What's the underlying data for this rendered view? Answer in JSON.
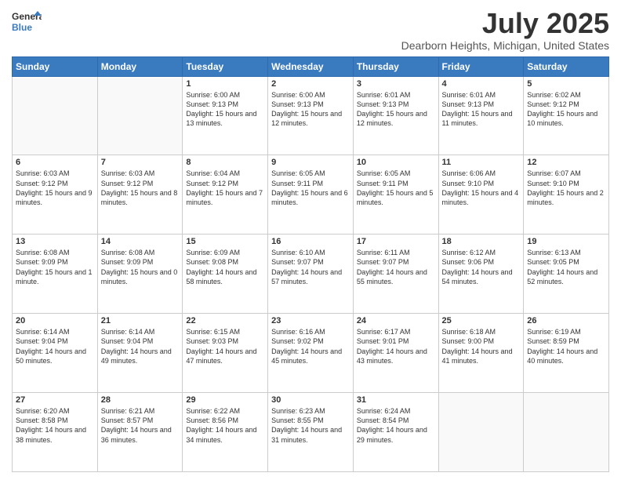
{
  "logo": {
    "line1": "General",
    "line2": "Blue"
  },
  "title": "July 2025",
  "subtitle": "Dearborn Heights, Michigan, United States",
  "headers": [
    "Sunday",
    "Monday",
    "Tuesday",
    "Wednesday",
    "Thursday",
    "Friday",
    "Saturday"
  ],
  "weeks": [
    [
      {
        "day": "",
        "info": ""
      },
      {
        "day": "",
        "info": ""
      },
      {
        "day": "1",
        "info": "Sunrise: 6:00 AM\nSunset: 9:13 PM\nDaylight: 15 hours and 13 minutes."
      },
      {
        "day": "2",
        "info": "Sunrise: 6:00 AM\nSunset: 9:13 PM\nDaylight: 15 hours and 12 minutes."
      },
      {
        "day": "3",
        "info": "Sunrise: 6:01 AM\nSunset: 9:13 PM\nDaylight: 15 hours and 12 minutes."
      },
      {
        "day": "4",
        "info": "Sunrise: 6:01 AM\nSunset: 9:13 PM\nDaylight: 15 hours and 11 minutes."
      },
      {
        "day": "5",
        "info": "Sunrise: 6:02 AM\nSunset: 9:12 PM\nDaylight: 15 hours and 10 minutes."
      }
    ],
    [
      {
        "day": "6",
        "info": "Sunrise: 6:03 AM\nSunset: 9:12 PM\nDaylight: 15 hours and 9 minutes."
      },
      {
        "day": "7",
        "info": "Sunrise: 6:03 AM\nSunset: 9:12 PM\nDaylight: 15 hours and 8 minutes."
      },
      {
        "day": "8",
        "info": "Sunrise: 6:04 AM\nSunset: 9:12 PM\nDaylight: 15 hours and 7 minutes."
      },
      {
        "day": "9",
        "info": "Sunrise: 6:05 AM\nSunset: 9:11 PM\nDaylight: 15 hours and 6 minutes."
      },
      {
        "day": "10",
        "info": "Sunrise: 6:05 AM\nSunset: 9:11 PM\nDaylight: 15 hours and 5 minutes."
      },
      {
        "day": "11",
        "info": "Sunrise: 6:06 AM\nSunset: 9:10 PM\nDaylight: 15 hours and 4 minutes."
      },
      {
        "day": "12",
        "info": "Sunrise: 6:07 AM\nSunset: 9:10 PM\nDaylight: 15 hours and 2 minutes."
      }
    ],
    [
      {
        "day": "13",
        "info": "Sunrise: 6:08 AM\nSunset: 9:09 PM\nDaylight: 15 hours and 1 minute."
      },
      {
        "day": "14",
        "info": "Sunrise: 6:08 AM\nSunset: 9:09 PM\nDaylight: 15 hours and 0 minutes."
      },
      {
        "day": "15",
        "info": "Sunrise: 6:09 AM\nSunset: 9:08 PM\nDaylight: 14 hours and 58 minutes."
      },
      {
        "day": "16",
        "info": "Sunrise: 6:10 AM\nSunset: 9:07 PM\nDaylight: 14 hours and 57 minutes."
      },
      {
        "day": "17",
        "info": "Sunrise: 6:11 AM\nSunset: 9:07 PM\nDaylight: 14 hours and 55 minutes."
      },
      {
        "day": "18",
        "info": "Sunrise: 6:12 AM\nSunset: 9:06 PM\nDaylight: 14 hours and 54 minutes."
      },
      {
        "day": "19",
        "info": "Sunrise: 6:13 AM\nSunset: 9:05 PM\nDaylight: 14 hours and 52 minutes."
      }
    ],
    [
      {
        "day": "20",
        "info": "Sunrise: 6:14 AM\nSunset: 9:04 PM\nDaylight: 14 hours and 50 minutes."
      },
      {
        "day": "21",
        "info": "Sunrise: 6:14 AM\nSunset: 9:04 PM\nDaylight: 14 hours and 49 minutes."
      },
      {
        "day": "22",
        "info": "Sunrise: 6:15 AM\nSunset: 9:03 PM\nDaylight: 14 hours and 47 minutes."
      },
      {
        "day": "23",
        "info": "Sunrise: 6:16 AM\nSunset: 9:02 PM\nDaylight: 14 hours and 45 minutes."
      },
      {
        "day": "24",
        "info": "Sunrise: 6:17 AM\nSunset: 9:01 PM\nDaylight: 14 hours and 43 minutes."
      },
      {
        "day": "25",
        "info": "Sunrise: 6:18 AM\nSunset: 9:00 PM\nDaylight: 14 hours and 41 minutes."
      },
      {
        "day": "26",
        "info": "Sunrise: 6:19 AM\nSunset: 8:59 PM\nDaylight: 14 hours and 40 minutes."
      }
    ],
    [
      {
        "day": "27",
        "info": "Sunrise: 6:20 AM\nSunset: 8:58 PM\nDaylight: 14 hours and 38 minutes."
      },
      {
        "day": "28",
        "info": "Sunrise: 6:21 AM\nSunset: 8:57 PM\nDaylight: 14 hours and 36 minutes."
      },
      {
        "day": "29",
        "info": "Sunrise: 6:22 AM\nSunset: 8:56 PM\nDaylight: 14 hours and 34 minutes."
      },
      {
        "day": "30",
        "info": "Sunrise: 6:23 AM\nSunset: 8:55 PM\nDaylight: 14 hours and 31 minutes."
      },
      {
        "day": "31",
        "info": "Sunrise: 6:24 AM\nSunset: 8:54 PM\nDaylight: 14 hours and 29 minutes."
      },
      {
        "day": "",
        "info": ""
      },
      {
        "day": "",
        "info": ""
      }
    ]
  ]
}
